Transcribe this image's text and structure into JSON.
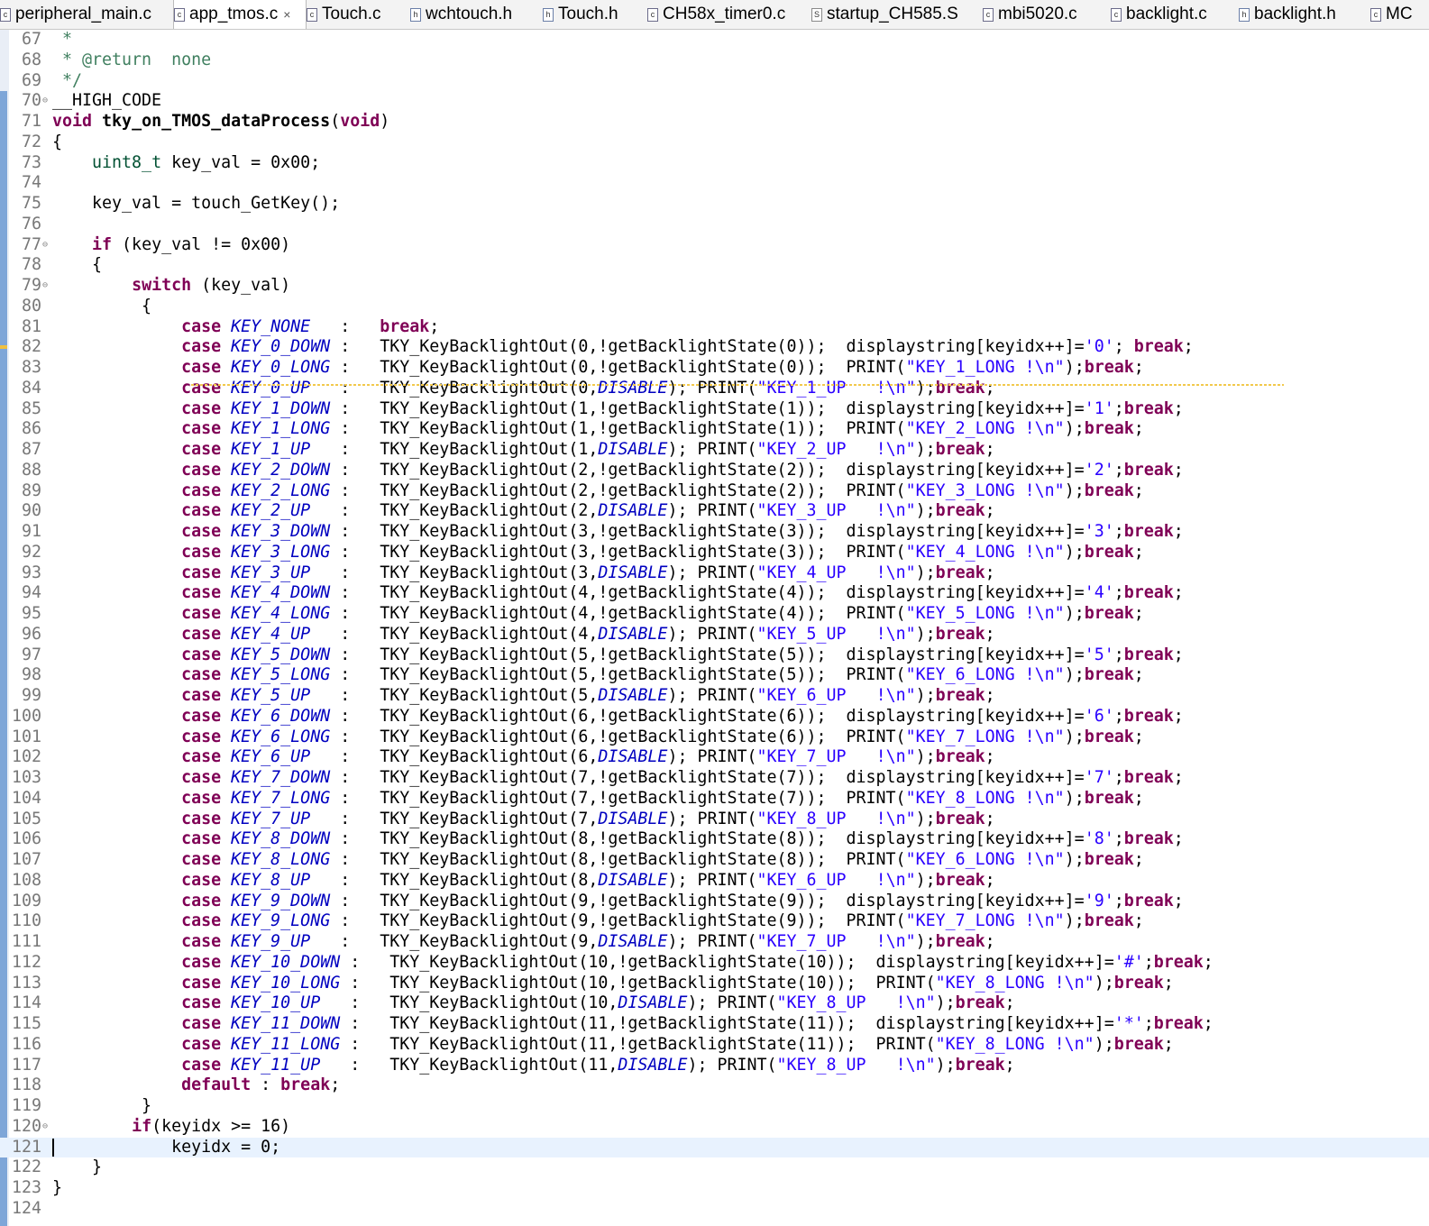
{
  "tabs": [
    {
      "label": "peripheral_main.c",
      "icon": "c-file-icon",
      "active": false
    },
    {
      "label": "app_tmos.c",
      "icon": "c-file-icon",
      "active": true
    },
    {
      "label": "Touch.c",
      "icon": "c-file-icon",
      "active": false
    },
    {
      "label": "wchtouch.h",
      "icon": "h-file-icon",
      "active": false
    },
    {
      "label": "Touch.h",
      "icon": "h-file-icon",
      "active": false
    },
    {
      "label": "CH58x_timer0.c",
      "icon": "c-file-icon",
      "active": false
    },
    {
      "label": "startup_CH585.S",
      "icon": "s-file-icon",
      "active": false
    },
    {
      "label": "mbi5020.c",
      "icon": "c-file-icon",
      "active": false
    },
    {
      "label": "backlight.c",
      "icon": "c-file-icon",
      "active": false
    },
    {
      "label": "backlight.h",
      "icon": "h-file-icon",
      "active": false
    },
    {
      "label": "MC",
      "icon": "c-file-icon",
      "active": false
    }
  ],
  "editor": {
    "current_line": 121,
    "lines": [
      {
        "n": "67",
        "fold": false,
        "html": "<span class=\"cm\"> *</span>"
      },
      {
        "n": "68",
        "fold": false,
        "html": "<span class=\"cm\"> * @return  none</span>"
      },
      {
        "n": "69",
        "fold": false,
        "html": "<span class=\"cm\"> */</span>"
      },
      {
        "n": "70",
        "fold": true,
        "html": "__HIGH_CODE"
      },
      {
        "n": "71",
        "fold": false,
        "html": "<span class=\"kw\">void</span> <b>tky_on_TMOS_dataProcess</b>(<span class=\"kw\">void</span>)"
      },
      {
        "n": "72",
        "fold": false,
        "html": "{"
      },
      {
        "n": "73",
        "fold": false,
        "html": "    <span class=\"ty\">uint8_t</span> key_val = 0x00;"
      },
      {
        "n": "74",
        "fold": false,
        "html": ""
      },
      {
        "n": "75",
        "fold": false,
        "html": "    key_val = touch_GetKey();"
      },
      {
        "n": "76",
        "fold": false,
        "html": ""
      },
      {
        "n": "77",
        "fold": true,
        "html": "    <span class=\"kw\">if</span> (key_val != 0x00)"
      },
      {
        "n": "78",
        "fold": false,
        "html": "    {"
      },
      {
        "n": "79",
        "fold": true,
        "html": "        <span class=\"kw\">switch</span> (key_val)"
      },
      {
        "n": "80",
        "fold": false,
        "html": "         {"
      },
      {
        "n": "81",
        "fold": false,
        "html": "             <span class=\"kw\">case</span> <span class=\"en\">KEY_NONE</span>   :   <span class=\"kw\">break</span>;"
      },
      {
        "n": "82",
        "fold": false,
        "html": "             <span class=\"kw\">case</span> <span class=\"en\">KEY_0_DOWN</span> :   TKY_KeyBacklightOut(0,!getBacklightState(0));  displaystring[keyidx++]=<span class=\"st\">'0'</span>; <span class=\"kw\">break</span>;"
      },
      {
        "n": "83",
        "fold": false,
        "html": "             <span class=\"kw\">case</span> <span class=\"en\">KEY_0_LONG</span> :   TKY_KeyBacklightOut(0,!getBacklightState(0));  PRINT(<span class=\"st\">\"KEY_1_LONG !\\n\"</span>);<span class=\"kw\">break</span>;"
      },
      {
        "n": "84",
        "fold": false,
        "html": "             <span class=\"kw\">case</span> <span class=\"en\">KEY_0_UP</span>   :   TKY_KeyBacklightOut(0,<span class=\"en\">DISABLE</span>); PRINT(<span class=\"st\">\"KEY_1_UP   !\\n\"</span>);<span class=\"kw\">break</span>;"
      },
      {
        "n": "85",
        "fold": false,
        "html": "             <span class=\"kw\">case</span> <span class=\"en\">KEY_1_DOWN</span> :   TKY_KeyBacklightOut(1,!getBacklightState(1));  displaystring[keyidx++]=<span class=\"st\">'1'</span>;<span class=\"kw\">break</span>;"
      },
      {
        "n": "86",
        "fold": false,
        "html": "             <span class=\"kw\">case</span> <span class=\"en\">KEY_1_LONG</span> :   TKY_KeyBacklightOut(1,!getBacklightState(1));  PRINT(<span class=\"st\">\"KEY_2_LONG !\\n\"</span>);<span class=\"kw\">break</span>;"
      },
      {
        "n": "87",
        "fold": false,
        "html": "             <span class=\"kw\">case</span> <span class=\"en\">KEY_1_UP</span>   :   TKY_KeyBacklightOut(1,<span class=\"en\">DISABLE</span>); PRINT(<span class=\"st\">\"KEY_2_UP   !\\n\"</span>);<span class=\"kw\">break</span>;"
      },
      {
        "n": "88",
        "fold": false,
        "html": "             <span class=\"kw\">case</span> <span class=\"en\">KEY_2_DOWN</span> :   TKY_KeyBacklightOut(2,!getBacklightState(2));  displaystring[keyidx++]=<span class=\"st\">'2'</span>;<span class=\"kw\">break</span>;"
      },
      {
        "n": "89",
        "fold": false,
        "html": "             <span class=\"kw\">case</span> <span class=\"en\">KEY_2_LONG</span> :   TKY_KeyBacklightOut(2,!getBacklightState(2));  PRINT(<span class=\"st\">\"KEY_3_LONG !\\n\"</span>);<span class=\"kw\">break</span>;"
      },
      {
        "n": "90",
        "fold": false,
        "html": "             <span class=\"kw\">case</span> <span class=\"en\">KEY_2_UP</span>   :   TKY_KeyBacklightOut(2,<span class=\"en\">DISABLE</span>); PRINT(<span class=\"st\">\"KEY_3_UP   !\\n\"</span>);<span class=\"kw\">break</span>;"
      },
      {
        "n": "91",
        "fold": false,
        "html": "             <span class=\"kw\">case</span> <span class=\"en\">KEY_3_DOWN</span> :   TKY_KeyBacklightOut(3,!getBacklightState(3));  displaystring[keyidx++]=<span class=\"st\">'3'</span>;<span class=\"kw\">break</span>;"
      },
      {
        "n": "92",
        "fold": false,
        "html": "             <span class=\"kw\">case</span> <span class=\"en\">KEY_3_LONG</span> :   TKY_KeyBacklightOut(3,!getBacklightState(3));  PRINT(<span class=\"st\">\"KEY_4_LONG !\\n\"</span>);<span class=\"kw\">break</span>;"
      },
      {
        "n": "93",
        "fold": false,
        "html": "             <span class=\"kw\">case</span> <span class=\"en\">KEY_3_UP</span>   :   TKY_KeyBacklightOut(3,<span class=\"en\">DISABLE</span>); PRINT(<span class=\"st\">\"KEY_4_UP   !\\n\"</span>);<span class=\"kw\">break</span>;"
      },
      {
        "n": "94",
        "fold": false,
        "html": "             <span class=\"kw\">case</span> <span class=\"en\">KEY_4_DOWN</span> :   TKY_KeyBacklightOut(4,!getBacklightState(4));  displaystring[keyidx++]=<span class=\"st\">'4'</span>;<span class=\"kw\">break</span>;"
      },
      {
        "n": "95",
        "fold": false,
        "html": "             <span class=\"kw\">case</span> <span class=\"en\">KEY_4_LONG</span> :   TKY_KeyBacklightOut(4,!getBacklightState(4));  PRINT(<span class=\"st\">\"KEY_5_LONG !\\n\"</span>);<span class=\"kw\">break</span>;"
      },
      {
        "n": "96",
        "fold": false,
        "html": "             <span class=\"kw\">case</span> <span class=\"en\">KEY_4_UP</span>   :   TKY_KeyBacklightOut(4,<span class=\"en\">DISABLE</span>); PRINT(<span class=\"st\">\"KEY_5_UP   !\\n\"</span>);<span class=\"kw\">break</span>;"
      },
      {
        "n": "97",
        "fold": false,
        "html": "             <span class=\"kw\">case</span> <span class=\"en\">KEY_5_DOWN</span> :   TKY_KeyBacklightOut(5,!getBacklightState(5));  displaystring[keyidx++]=<span class=\"st\">'5'</span>;<span class=\"kw\">break</span>;"
      },
      {
        "n": "98",
        "fold": false,
        "html": "             <span class=\"kw\">case</span> <span class=\"en\">KEY_5_LONG</span> :   TKY_KeyBacklightOut(5,!getBacklightState(5));  PRINT(<span class=\"st\">\"KEY_6_LONG !\\n\"</span>);<span class=\"kw\">break</span>;"
      },
      {
        "n": "99",
        "fold": false,
        "html": "             <span class=\"kw\">case</span> <span class=\"en\">KEY_5_UP</span>   :   TKY_KeyBacklightOut(5,<span class=\"en\">DISABLE</span>); PRINT(<span class=\"st\">\"KEY_6_UP   !\\n\"</span>);<span class=\"kw\">break</span>;"
      },
      {
        "n": "100",
        "fold": false,
        "html": "             <span class=\"kw\">case</span> <span class=\"en\">KEY_6_DOWN</span> :   TKY_KeyBacklightOut(6,!getBacklightState(6));  displaystring[keyidx++]=<span class=\"st\">'6'</span>;<span class=\"kw\">break</span>;"
      },
      {
        "n": "101",
        "fold": false,
        "html": "             <span class=\"kw\">case</span> <span class=\"en\">KEY_6_LONG</span> :   TKY_KeyBacklightOut(6,!getBacklightState(6));  PRINT(<span class=\"st\">\"KEY_7_LONG !\\n\"</span>);<span class=\"kw\">break</span>;"
      },
      {
        "n": "102",
        "fold": false,
        "html": "             <span class=\"kw\">case</span> <span class=\"en\">KEY_6_UP</span>   :   TKY_KeyBacklightOut(6,<span class=\"en\">DISABLE</span>); PRINT(<span class=\"st\">\"KEY_7_UP   !\\n\"</span>);<span class=\"kw\">break</span>;"
      },
      {
        "n": "103",
        "fold": false,
        "html": "             <span class=\"kw\">case</span> <span class=\"en\">KEY_7_DOWN</span> :   TKY_KeyBacklightOut(7,!getBacklightState(7));  displaystring[keyidx++]=<span class=\"st\">'7'</span>;<span class=\"kw\">break</span>;"
      },
      {
        "n": "104",
        "fold": false,
        "html": "             <span class=\"kw\">case</span> <span class=\"en\">KEY_7_LONG</span> :   TKY_KeyBacklightOut(7,!getBacklightState(7));  PRINT(<span class=\"st\">\"KEY_8_LONG !\\n\"</span>);<span class=\"kw\">break</span>;"
      },
      {
        "n": "105",
        "fold": false,
        "html": "             <span class=\"kw\">case</span> <span class=\"en\">KEY_7_UP</span>   :   TKY_KeyBacklightOut(7,<span class=\"en\">DISABLE</span>); PRINT(<span class=\"st\">\"KEY_8_UP   !\\n\"</span>);<span class=\"kw\">break</span>;"
      },
      {
        "n": "106",
        "fold": false,
        "html": "             <span class=\"kw\">case</span> <span class=\"en\">KEY_8_DOWN</span> :   TKY_KeyBacklightOut(8,!getBacklightState(8));  displaystring[keyidx++]=<span class=\"st\">'8'</span>;<span class=\"kw\">break</span>;"
      },
      {
        "n": "107",
        "fold": false,
        "html": "             <span class=\"kw\">case</span> <span class=\"en\">KEY_8_LONG</span> :   TKY_KeyBacklightOut(8,!getBacklightState(8));  PRINT(<span class=\"st\">\"KEY_6_LONG !\\n\"</span>);<span class=\"kw\">break</span>;"
      },
      {
        "n": "108",
        "fold": false,
        "html": "             <span class=\"kw\">case</span> <span class=\"en\">KEY_8_UP</span>   :   TKY_KeyBacklightOut(8,<span class=\"en\">DISABLE</span>); PRINT(<span class=\"st\">\"KEY_6_UP   !\\n\"</span>);<span class=\"kw\">break</span>;"
      },
      {
        "n": "109",
        "fold": false,
        "html": "             <span class=\"kw\">case</span> <span class=\"en\">KEY_9_DOWN</span> :   TKY_KeyBacklightOut(9,!getBacklightState(9));  displaystring[keyidx++]=<span class=\"st\">'9'</span>;<span class=\"kw\">break</span>;"
      },
      {
        "n": "110",
        "fold": false,
        "html": "             <span class=\"kw\">case</span> <span class=\"en\">KEY_9_LONG</span> :   TKY_KeyBacklightOut(9,!getBacklightState(9));  PRINT(<span class=\"st\">\"KEY_7_LONG !\\n\"</span>);<span class=\"kw\">break</span>;"
      },
      {
        "n": "111",
        "fold": false,
        "html": "             <span class=\"kw\">case</span> <span class=\"en\">KEY_9_UP</span>   :   TKY_KeyBacklightOut(9,<span class=\"en\">DISABLE</span>); PRINT(<span class=\"st\">\"KEY_7_UP   !\\n\"</span>);<span class=\"kw\">break</span>;"
      },
      {
        "n": "112",
        "fold": false,
        "html": "             <span class=\"kw\">case</span> <span class=\"en\">KEY_10_DOWN</span> :   TKY_KeyBacklightOut(10,!getBacklightState(10));  displaystring[keyidx++]=<span class=\"st\">'#'</span>;<span class=\"kw\">break</span>;"
      },
      {
        "n": "113",
        "fold": false,
        "html": "             <span class=\"kw\">case</span> <span class=\"en\">KEY_10_LONG</span> :   TKY_KeyBacklightOut(10,!getBacklightState(10));  PRINT(<span class=\"st\">\"KEY_8_LONG !\\n\"</span>);<span class=\"kw\">break</span>;"
      },
      {
        "n": "114",
        "fold": false,
        "html": "             <span class=\"kw\">case</span> <span class=\"en\">KEY_10_UP</span>   :   TKY_KeyBacklightOut(10,<span class=\"en\">DISABLE</span>); PRINT(<span class=\"st\">\"KEY_8_UP   !\\n\"</span>);<span class=\"kw\">break</span>;"
      },
      {
        "n": "115",
        "fold": false,
        "html": "             <span class=\"kw\">case</span> <span class=\"en\">KEY_11_DOWN</span> :   TKY_KeyBacklightOut(11,!getBacklightState(11));  displaystring[keyidx++]=<span class=\"st\">'*'</span>;<span class=\"kw\">break</span>;"
      },
      {
        "n": "116",
        "fold": false,
        "html": "             <span class=\"kw\">case</span> <span class=\"en\">KEY_11_LONG</span> :   TKY_KeyBacklightOut(11,!getBacklightState(11));  PRINT(<span class=\"st\">\"KEY_8_LONG !\\n\"</span>);<span class=\"kw\">break</span>;"
      },
      {
        "n": "117",
        "fold": false,
        "html": "             <span class=\"kw\">case</span> <span class=\"en\">KEY_11_UP</span>   :   TKY_KeyBacklightOut(11,<span class=\"en\">DISABLE</span>); PRINT(<span class=\"st\">\"KEY_8_UP   !\\n\"</span>);<span class=\"kw\">break</span>;"
      },
      {
        "n": "118",
        "fold": false,
        "html": "             <span class=\"kw\">default</span> : <span class=\"kw\">break</span>;"
      },
      {
        "n": "119",
        "fold": false,
        "html": "         }"
      },
      {
        "n": "120",
        "fold": true,
        "html": "        <span class=\"kw\">if</span>(keyidx >= 16)"
      },
      {
        "n": "121",
        "fold": false,
        "html": "            keyidx = 0;"
      },
      {
        "n": "122",
        "fold": false,
        "html": "    }"
      },
      {
        "n": "123",
        "fold": false,
        "html": "}"
      },
      {
        "n": "124",
        "fold": false,
        "html": ""
      }
    ]
  }
}
